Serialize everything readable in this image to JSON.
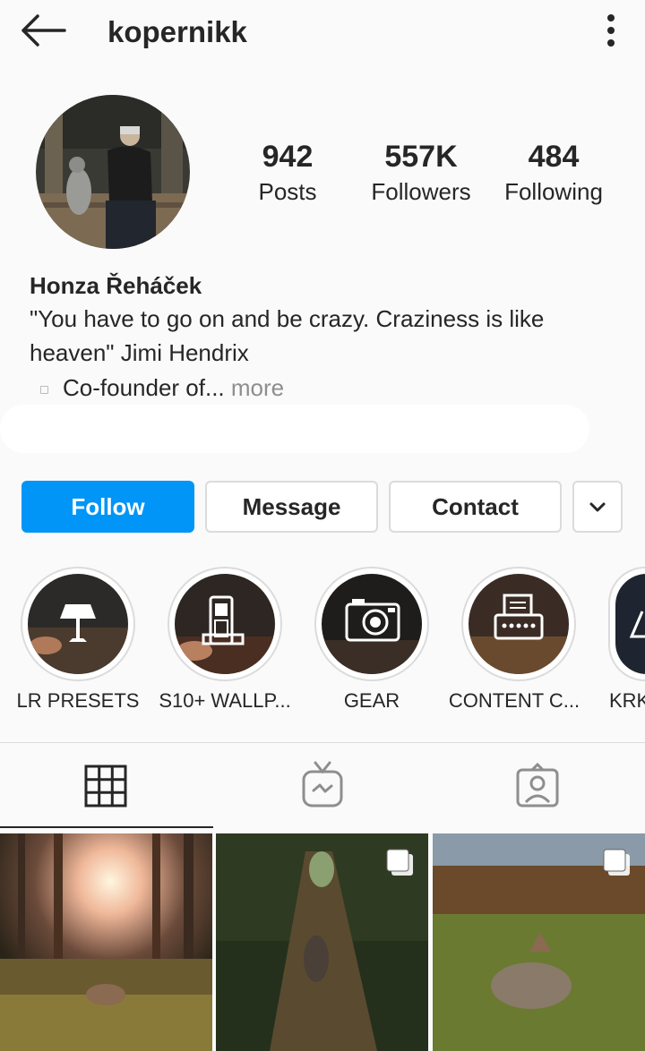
{
  "header": {
    "username": "kopernikk"
  },
  "stats": [
    {
      "value": "942",
      "label": "Posts"
    },
    {
      "value": "557K",
      "label": "Followers"
    },
    {
      "value": "484",
      "label": "Following"
    }
  ],
  "bio": {
    "name": "Honza Řeháček",
    "line1": "\"You have to go on and be crazy. Craziness is like",
    "line2": "heaven\" Jimi Hendrix",
    "line3": "Co-founder of",
    "ellipsis": "...",
    "more": " more"
  },
  "actions": {
    "follow": "Follow",
    "message": "Message",
    "contact": "Contact"
  },
  "highlights": [
    {
      "label": "LR PRESETS",
      "icon": "lamp-icon"
    },
    {
      "label": "S10+ WALLP...",
      "icon": "phone-icon"
    },
    {
      "label": "GEAR",
      "icon": "camera-icon"
    },
    {
      "label": "CONTENT C...",
      "icon": "typewriter-icon"
    },
    {
      "label": "KRK",
      "icon": "triangle-icon"
    }
  ],
  "tabs": [
    "grid-icon",
    "igtv-icon",
    "tagged-icon"
  ],
  "colors": {
    "accent": "#0095f6",
    "text": "#262626",
    "muted": "#8e8e8e",
    "border": "#dbdbdb",
    "background": "#fafafa"
  }
}
